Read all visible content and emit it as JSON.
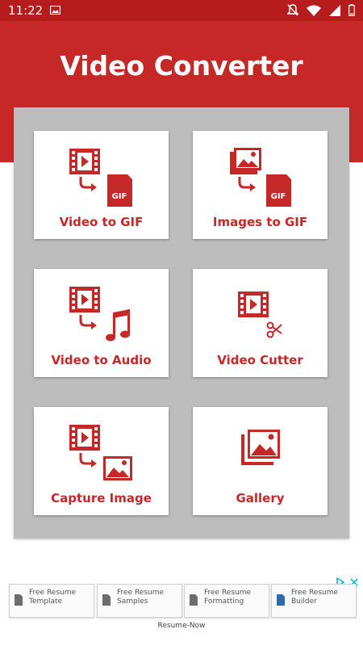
{
  "status_bar": {
    "time": "11:22",
    "icons": [
      "image-icon",
      "notifications-off-icon",
      "wifi-icon",
      "network-icon",
      "battery-low-icon"
    ]
  },
  "header": {
    "title": "Video Converter",
    "color": "#c62828"
  },
  "tiles": [
    {
      "label": "Video to GIF",
      "icon": "video-to-gif-icon"
    },
    {
      "label": "Images to GIF",
      "icon": "images-to-gif-icon"
    },
    {
      "label": "Video to Audio",
      "icon": "video-to-audio-icon"
    },
    {
      "label": "Video Cutter",
      "icon": "video-cutter-icon"
    },
    {
      "label": "Capture Image",
      "icon": "capture-image-icon"
    },
    {
      "label": "Gallery",
      "icon": "gallery-icon"
    }
  ],
  "ad": {
    "chips": [
      {
        "line1": "Free Resume",
        "line2": "Template"
      },
      {
        "line1": "Free Resume",
        "line2": "Samples"
      },
      {
        "line1": "Free Resume",
        "line2": "Formatting"
      },
      {
        "line1": "Free Resume",
        "line2": "Builder"
      }
    ],
    "footer": "Resume-Now",
    "choices_icons": [
      "adchoices-icon",
      "close-icon"
    ]
  },
  "colors": {
    "accent": "#c62828",
    "status_bar": "#b71c1c",
    "panel": "#bdbdbd"
  }
}
